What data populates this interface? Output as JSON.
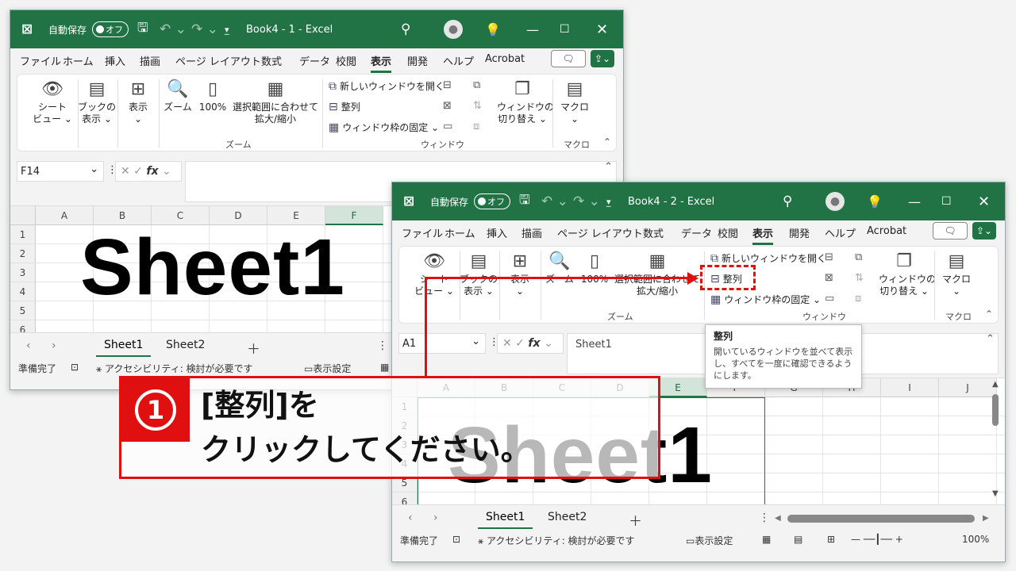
{
  "common": {
    "autosave_label": "自動保存",
    "autosave_state": "オフ",
    "menu": [
      "ファイル",
      "ホーム",
      "挿入",
      "描画",
      "ページ レイアウト",
      "数式",
      "データ",
      "校閲",
      "表示",
      "開発",
      "ヘルプ",
      "Acrobat"
    ],
    "active_menu": "表示",
    "ribbon": {
      "sheet_view": "シート\nビュー ⌄",
      "book_view": "ブックの\n表示 ⌄",
      "show": "表示\n⌄",
      "zoom": "ズーム",
      "zoom100": "100%",
      "zoom_sel": "選択範囲に合わせて\n拡大/縮小",
      "zoom_group": "ズーム",
      "new_window": "新しいウィンドウを開く",
      "arrange": "整列",
      "freeze": "ウィンドウ枠の固定 ⌄",
      "switch": "ウィンドウの\n切り替え ⌄",
      "window_group": "ウィンドウ",
      "macro": "マクロ\n⌄",
      "macro_group": "マクロ"
    },
    "sheet_text": "Sheet1",
    "tabs": [
      "Sheet1",
      "Sheet2"
    ],
    "status_ready": "準備完了",
    "status_access": "アクセシビリティ: 検討が必要です",
    "display_settings": "表示設定",
    "zoom_level": "100%"
  },
  "win1": {
    "title": "Book4 - 1 - Excel",
    "namebox": "F14",
    "columns": [
      "A",
      "B",
      "C",
      "D",
      "E",
      "F"
    ],
    "rows": [
      "1",
      "2",
      "3",
      "4",
      "5",
      "6"
    ]
  },
  "win2": {
    "title": "Book4 - 2 - Excel",
    "namebox": "A1",
    "formula": "Sheet1",
    "columns": [
      "A",
      "B",
      "C",
      "D",
      "E",
      "F",
      "G",
      "H",
      "I",
      "J"
    ],
    "rows": [
      "1",
      "2",
      "3",
      "4",
      "5",
      "6"
    ]
  },
  "tooltip": {
    "title": "整列",
    "body": "開いているウィンドウを並べて表示し、すべてを一度に確認できるようにします。"
  },
  "callout": {
    "number": "1",
    "line1": "[整列]を",
    "line2": "クリックしてください。"
  },
  "colors": {
    "excel_green": "#217346",
    "highlight_red": "#e01010"
  }
}
